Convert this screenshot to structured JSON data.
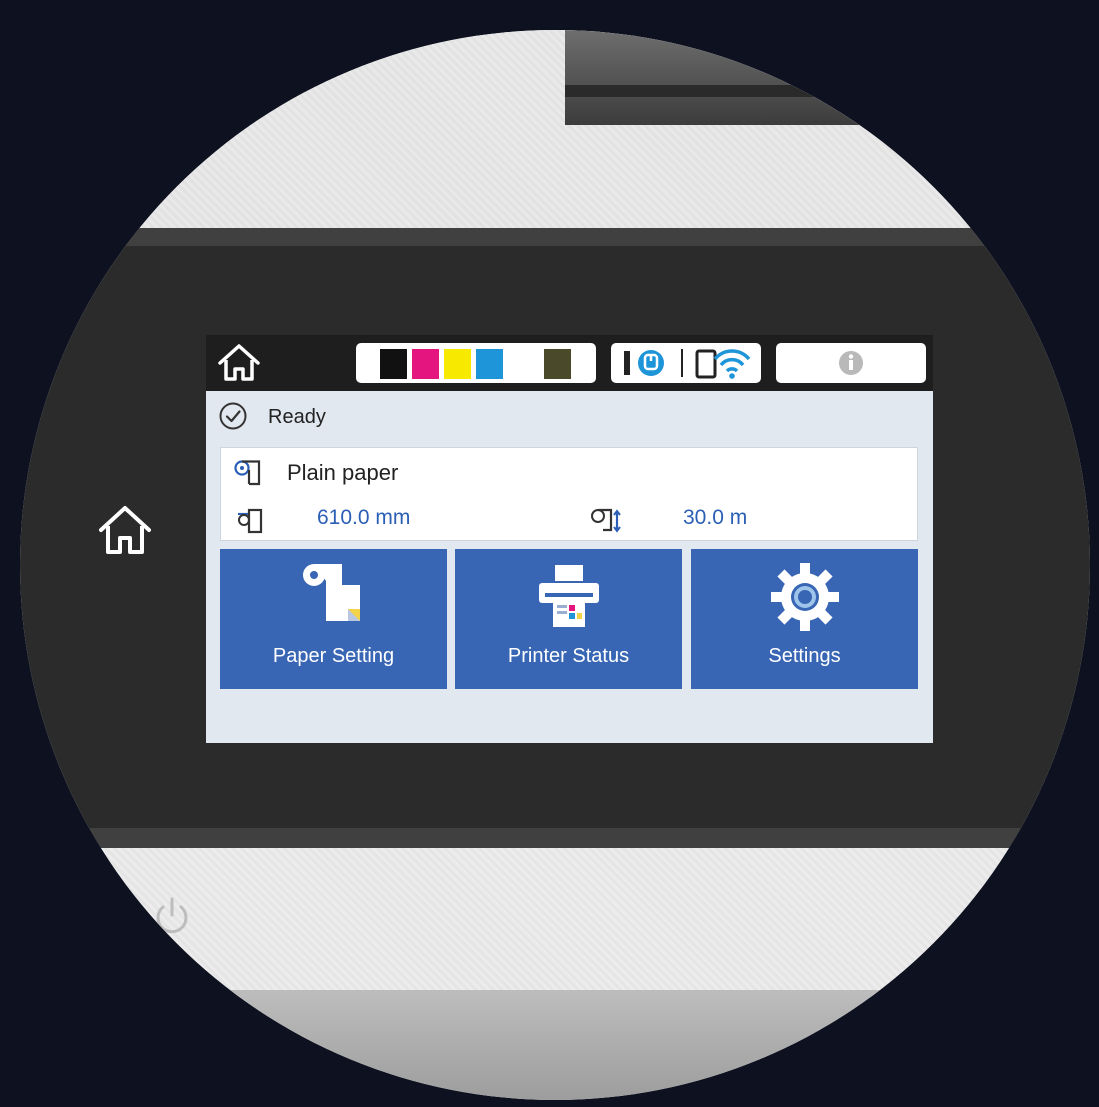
{
  "status": {
    "state_text": "Ready"
  },
  "ink_levels": [
    {
      "name": "black",
      "color": "#111111"
    },
    {
      "name": "magenta",
      "color": "#e5157f"
    },
    {
      "name": "yellow",
      "color": "#f7ea00"
    },
    {
      "name": "cyan",
      "color": "#1e95d8"
    },
    {
      "name": "matte-black",
      "color": "#4a4a2a"
    }
  ],
  "paper": {
    "type": "Plain paper",
    "width": "610.0 mm",
    "remaining": "30.0 m"
  },
  "tiles": [
    {
      "label": "Paper Setting",
      "icon": "paper-roll-icon"
    },
    {
      "label": "Printer Status",
      "icon": "printer-icon"
    },
    {
      "label": "Settings",
      "icon": "gear-icon"
    }
  ],
  "colors": {
    "tile_blue": "#3866b4",
    "accent_text": "#2b5fb5",
    "screen_bg": "#e2e8ef"
  }
}
